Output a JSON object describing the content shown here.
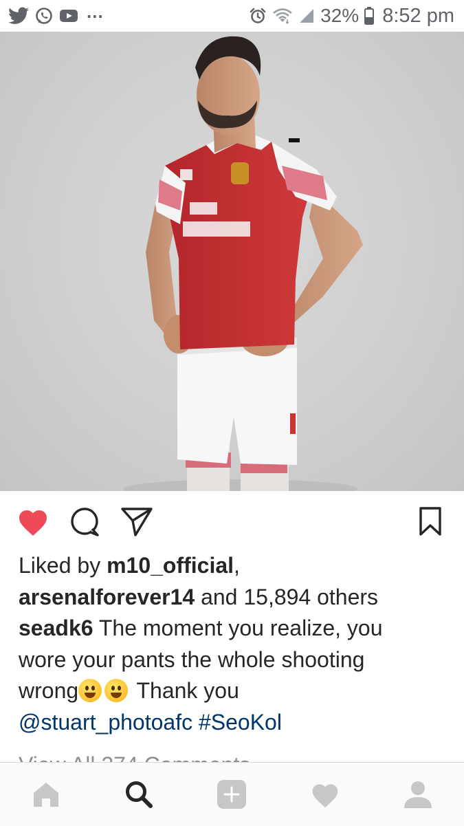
{
  "status_bar": {
    "icons_left": [
      "twitter-icon",
      "whatsapp-icon",
      "youtube-icon"
    ],
    "more": "...",
    "icons_right": [
      "alarm-icon",
      "wifi-icon",
      "cell-signal-icon",
      "battery-icon"
    ],
    "battery": "32%",
    "time": "8:52 pm"
  },
  "post": {
    "photo": "image",
    "liked": true,
    "likes": {
      "prefix": "Liked by",
      "user1": "m10_official",
      "user1_suffix": ",",
      "user2": "arsenalforever14",
      "suffix": "and 15,894 others"
    },
    "caption": {
      "username": "seadk6",
      "line1_text": "The moment you realize, you",
      "line2_text": "wore your pants the whole shooting",
      "line3_text_before": "wrong",
      "emojis": [
        "😛",
        "😛"
      ],
      "line3_text_after": "Thank you",
      "mention": "@stuart_photoafc",
      "hashtag": "#SeoKol"
    },
    "view_comments": "View All 274 Comments"
  },
  "bottom_nav": {
    "items": [
      "home-icon",
      "search-icon",
      "add-post-icon",
      "activity-icon",
      "profile-icon"
    ],
    "active": "search-icon"
  },
  "colors": {
    "like_red": "#ed4956",
    "link_blue": "#003569",
    "text": "#262626",
    "muted": "#8e8e8e",
    "nav_inactive": "#c7c7c7"
  }
}
